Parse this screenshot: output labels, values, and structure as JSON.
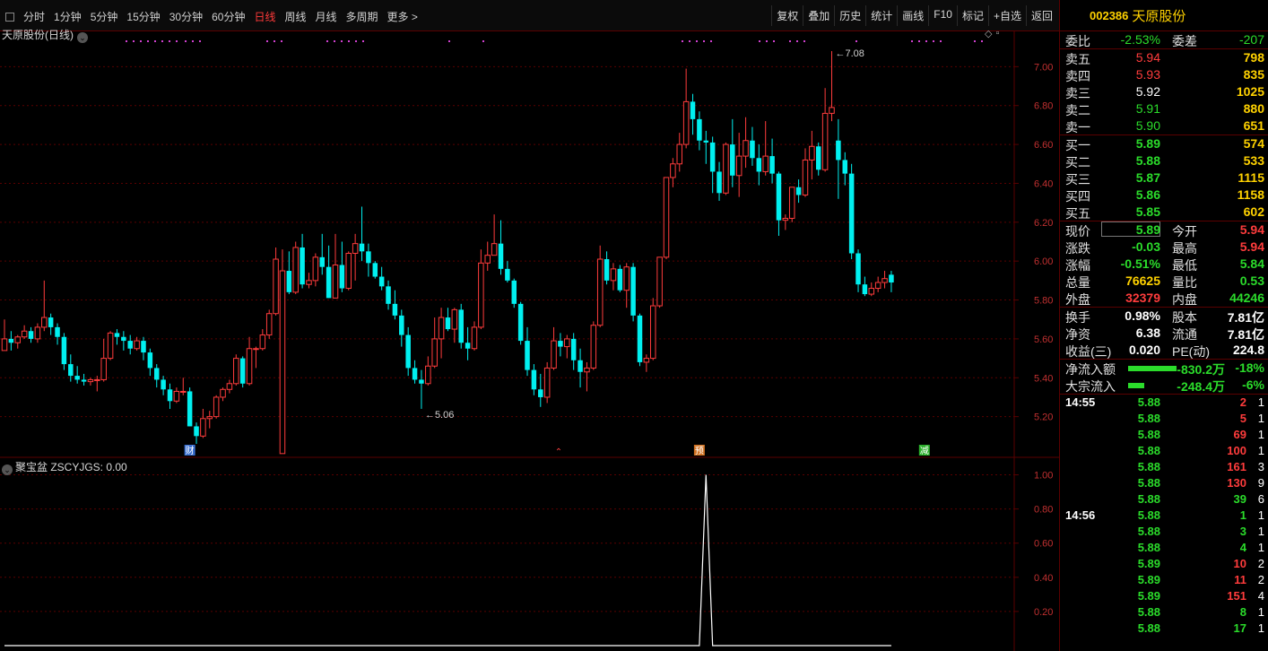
{
  "toolbar": {
    "periods": [
      "分时",
      "1分钟",
      "5分钟",
      "15分钟",
      "30分钟",
      "60分钟",
      "日线",
      "周线",
      "月线",
      "多周期",
      "更多 >"
    ],
    "active_period": "日线",
    "actions": [
      "复权",
      "叠加",
      "历史",
      "统计",
      "画线",
      "F10",
      "标记",
      "+自选",
      "返回"
    ]
  },
  "chart_title": "天原股份(日线)",
  "indicator_title": "聚宝盆  ZSCYJGS: 0.00",
  "colors": {
    "up": "#ff3c3c",
    "down": "#00f0f0",
    "grid": "#5a0000",
    "axis_text": "#c03030"
  },
  "chart_data": [
    {
      "type": "candlestick",
      "ylim": [
        5.0,
        7.14
      ],
      "yticks": [
        "7.00",
        "6.80",
        "6.60",
        "6.40",
        "6.20",
        "6.00",
        "5.80",
        "5.60",
        "5.40",
        "5.20"
      ],
      "annotations": {
        "high_label": "7.08",
        "low_label": "5.06"
      },
      "event_markers": [
        "财",
        "预",
        "减"
      ],
      "candles": [
        [
          5.54,
          5.7,
          5.57,
          5.6
        ],
        [
          5.6,
          5.64,
          5.54,
          5.58
        ],
        [
          5.58,
          5.62,
          5.55,
          5.61
        ],
        [
          5.61,
          5.67,
          5.6,
          5.64
        ],
        [
          5.64,
          5.66,
          5.58,
          5.6
        ],
        [
          5.6,
          5.68,
          5.58,
          5.66
        ],
        [
          5.66,
          5.9,
          5.64,
          5.71
        ],
        [
          5.71,
          5.73,
          5.62,
          5.66
        ],
        [
          5.66,
          5.68,
          5.57,
          5.61
        ],
        [
          5.61,
          5.63,
          5.44,
          5.47
        ],
        [
          5.47,
          5.52,
          5.38,
          5.41
        ],
        [
          5.41,
          5.46,
          5.37,
          5.39
        ],
        [
          5.39,
          5.42,
          5.36,
          5.38
        ],
        [
          5.38,
          5.4,
          5.36,
          5.39
        ],
        [
          5.39,
          5.41,
          5.33,
          5.39
        ],
        [
          5.39,
          5.6,
          5.38,
          5.5
        ],
        [
          5.5,
          5.64,
          5.49,
          5.63
        ],
        [
          5.63,
          5.65,
          5.57,
          5.61
        ],
        [
          5.61,
          5.64,
          5.54,
          5.59
        ],
        [
          5.59,
          5.62,
          5.52,
          5.55
        ],
        [
          5.55,
          5.61,
          5.54,
          5.59
        ],
        [
          5.59,
          5.61,
          5.49,
          5.53
        ],
        [
          5.53,
          5.55,
          5.41,
          5.45
        ],
        [
          5.45,
          5.47,
          5.35,
          5.39
        ],
        [
          5.39,
          5.41,
          5.31,
          5.34
        ],
        [
          5.34,
          5.37,
          5.24,
          5.28
        ],
        [
          5.28,
          5.35,
          5.27,
          5.33
        ],
        [
          5.33,
          5.4,
          5.31,
          5.33
        ],
        [
          5.33,
          5.35,
          5.17,
          5.15
        ],
        [
          5.15,
          5.17,
          5.06,
          5.1
        ],
        [
          5.1,
          5.24,
          5.09,
          5.19
        ],
        [
          5.19,
          5.23,
          5.14,
          5.2
        ],
        [
          5.2,
          5.31,
          5.19,
          5.3
        ],
        [
          5.3,
          5.35,
          5.28,
          5.34
        ],
        [
          5.34,
          5.39,
          5.32,
          5.37
        ],
        [
          5.37,
          5.52,
          5.36,
          5.5
        ],
        [
          5.5,
          5.51,
          5.35,
          5.37
        ],
        [
          5.37,
          5.61,
          5.36,
          5.55
        ],
        [
          5.55,
          5.56,
          5.45,
          5.55
        ],
        [
          5.55,
          5.65,
          5.54,
          5.62
        ],
        [
          5.62,
          5.75,
          5.6,
          5.73
        ],
        [
          5.73,
          6.07,
          5.72,
          6.01
        ],
        [
          5.01,
          6.06,
          5.88,
          5.95
        ],
        [
          5.95,
          6.05,
          5.83,
          5.84
        ],
        [
          5.84,
          6.1,
          5.83,
          6.07
        ],
        [
          6.07,
          6.14,
          5.86,
          5.88
        ],
        [
          5.88,
          5.94,
          5.86,
          5.9
        ],
        [
          5.9,
          6.04,
          5.87,
          6.02
        ],
        [
          6.02,
          6.14,
          5.93,
          5.97
        ],
        [
          5.97,
          6.08,
          5.81,
          5.81
        ],
        [
          5.81,
          6.14,
          5.81,
          5.98
        ],
        [
          5.98,
          6.1,
          5.84,
          5.86
        ],
        [
          5.86,
          6.05,
          5.85,
          6.04
        ],
        [
          6.04,
          6.14,
          5.9,
          6.09
        ],
        [
          6.09,
          6.28,
          6.0,
          6.05
        ],
        [
          6.05,
          6.09,
          5.92,
          5.99
        ],
        [
          5.99,
          6.0,
          5.91,
          5.92
        ],
        [
          5.92,
          5.97,
          5.85,
          5.87
        ],
        [
          5.87,
          5.9,
          5.75,
          5.78
        ],
        [
          5.78,
          5.85,
          5.7,
          5.72
        ],
        [
          5.72,
          5.75,
          5.56,
          5.62
        ],
        [
          5.62,
          5.66,
          5.41,
          5.45
        ],
        [
          5.45,
          5.49,
          5.37,
          5.39
        ],
        [
          5.39,
          5.44,
          5.24,
          5.37
        ],
        [
          5.37,
          5.51,
          5.36,
          5.46
        ],
        [
          5.46,
          5.71,
          5.45,
          5.6
        ],
        [
          5.6,
          5.76,
          5.5,
          5.71
        ],
        [
          5.71,
          5.76,
          5.64,
          5.65
        ],
        [
          5.65,
          5.76,
          5.58,
          5.75
        ],
        [
          5.75,
          5.78,
          5.55,
          5.58
        ],
        [
          5.58,
          5.66,
          5.49,
          5.55
        ],
        [
          5.55,
          5.69,
          5.54,
          5.66
        ],
        [
          5.66,
          6.06,
          5.65,
          5.99
        ],
        [
          5.99,
          6.1,
          5.95,
          6.03
        ],
        [
          6.03,
          6.24,
          6.03,
          6.09
        ],
        [
          6.09,
          6.21,
          5.93,
          5.96
        ],
        [
          5.96,
          6.0,
          5.89,
          5.9
        ],
        [
          5.9,
          5.91,
          5.76,
          5.78
        ],
        [
          5.78,
          5.79,
          5.57,
          5.59
        ],
        [
          5.59,
          5.66,
          5.41,
          5.44
        ],
        [
          5.44,
          5.47,
          5.31,
          5.34
        ],
        [
          5.34,
          5.42,
          5.25,
          5.3
        ],
        [
          5.3,
          5.48,
          5.27,
          5.45
        ],
        [
          5.45,
          5.66,
          5.44,
          5.59
        ],
        [
          5.59,
          5.63,
          5.51,
          5.56
        ],
        [
          5.56,
          5.62,
          5.5,
          5.6
        ],
        [
          5.6,
          5.63,
          5.44,
          5.49
        ],
        [
          5.49,
          5.55,
          5.35,
          5.43
        ],
        [
          5.43,
          5.48,
          5.33,
          5.45
        ],
        [
          5.45,
          5.69,
          5.44,
          5.67
        ],
        [
          5.67,
          6.08,
          5.66,
          6.01
        ],
        [
          6.01,
          6.05,
          5.88,
          5.9
        ],
        [
          5.9,
          5.99,
          5.85,
          5.96
        ],
        [
          5.96,
          5.98,
          5.84,
          5.85
        ],
        [
          5.85,
          5.99,
          5.76,
          5.97
        ],
        [
          5.97,
          5.99,
          5.69,
          5.72
        ],
        [
          5.72,
          5.73,
          5.46,
          5.48
        ],
        [
          5.48,
          5.52,
          5.43,
          5.5
        ],
        [
          5.5,
          5.81,
          5.49,
          5.77
        ],
        [
          5.77,
          6.0,
          5.76,
          6.02
        ],
        [
          6.02,
          6.4,
          6.01,
          6.43
        ],
        [
          6.43,
          6.53,
          6.38,
          6.5
        ],
        [
          6.5,
          6.66,
          6.46,
          6.6
        ],
        [
          6.6,
          6.99,
          6.58,
          6.82
        ],
        [
          6.82,
          6.86,
          6.65,
          6.73
        ],
        [
          6.73,
          6.77,
          6.57,
          6.62
        ],
        [
          6.62,
          6.67,
          6.5,
          6.61
        ],
        [
          6.61,
          6.64,
          6.35,
          6.46
        ],
        [
          6.46,
          6.51,
          6.31,
          6.35
        ],
        [
          6.35,
          6.61,
          6.34,
          6.6
        ],
        [
          6.6,
          6.73,
          6.38,
          6.44
        ],
        [
          6.44,
          6.66,
          6.33,
          6.54
        ],
        [
          6.54,
          6.74,
          6.48,
          6.62
        ],
        [
          6.62,
          6.69,
          6.49,
          6.53
        ],
        [
          6.53,
          6.6,
          6.39,
          6.46
        ],
        [
          6.46,
          6.72,
          6.44,
          6.54
        ],
        [
          6.54,
          6.63,
          6.4,
          6.45
        ],
        [
          6.45,
          6.46,
          6.13,
          6.21
        ],
        [
          6.21,
          6.24,
          6.16,
          6.22
        ],
        [
          6.22,
          6.38,
          6.2,
          6.38
        ],
        [
          6.38,
          6.42,
          6.3,
          6.34
        ],
        [
          6.34,
          6.58,
          6.33,
          6.52
        ],
        [
          6.52,
          6.67,
          6.42,
          6.59
        ],
        [
          6.59,
          6.61,
          6.44,
          6.47
        ],
        [
          6.47,
          6.89,
          6.46,
          6.76
        ],
        [
          6.76,
          7.08,
          6.72,
          6.79
        ],
        [
          6.79,
          6.73,
          6.32,
          6.52
        ],
        [
          6.52,
          6.56,
          6.39,
          6.45
        ],
        [
          6.45,
          6.5,
          6.01,
          6.04
        ],
        [
          6.04,
          6.06,
          5.84,
          5.88
        ],
        [
          5.88,
          5.92,
          5.82,
          5.83
        ],
        [
          5.83,
          5.89,
          5.82,
          5.86
        ],
        [
          5.86,
          5.92,
          5.84,
          5.89
        ],
        [
          5.89,
          5.95,
          5.86,
          5.91
        ],
        [
          5.93,
          5.95,
          5.84,
          5.89
        ]
      ]
    },
    {
      "type": "line",
      "name": "ZSCYJGS",
      "ylim": [
        0,
        1.05
      ],
      "yticks": [
        "1.00",
        "0.80",
        "0.60",
        "0.40",
        "0.20"
      ],
      "spike_index": 106,
      "spike_value": 1.0
    }
  ],
  "quote": {
    "code": "002386",
    "name": "天原股份",
    "weibi_label": "委比",
    "weibi": "-2.53%",
    "weicha_label": "委差",
    "weicha": "-207",
    "asks": [
      {
        "label": "卖五",
        "price": "5.94",
        "vol": "798"
      },
      {
        "label": "卖四",
        "price": "5.93",
        "vol": "835"
      },
      {
        "label": "卖三",
        "price": "5.92",
        "vol": "1025"
      },
      {
        "label": "卖二",
        "price": "5.91",
        "vol": "880"
      },
      {
        "label": "卖一",
        "price": "5.90",
        "vol": "651"
      }
    ],
    "bids": [
      {
        "label": "买一",
        "price": "5.89",
        "vol": "574"
      },
      {
        "label": "买二",
        "price": "5.88",
        "vol": "533"
      },
      {
        "label": "买三",
        "price": "5.87",
        "vol": "1115"
      },
      {
        "label": "买四",
        "price": "5.86",
        "vol": "1158"
      },
      {
        "label": "买五",
        "price": "5.85",
        "vol": "602"
      }
    ],
    "stats": [
      {
        "l1": "现价",
        "v1": "5.89",
        "l2": "今开",
        "v2": "5.94"
      },
      {
        "l1": "涨跌",
        "v1": "-0.03",
        "l2": "最高",
        "v2": "5.94"
      },
      {
        "l1": "涨幅",
        "v1": "-0.51%",
        "l2": "最低",
        "v2": "5.84"
      },
      {
        "l1": "总量",
        "v1": "76625",
        "l2": "量比",
        "v2": "0.53"
      },
      {
        "l1": "外盘",
        "v1": "32379",
        "l2": "内盘",
        "v2": "44246"
      }
    ],
    "fund": [
      {
        "l1": "换手",
        "v1": "0.98%",
        "l2": "股本",
        "v2": "7.81亿"
      },
      {
        "l1": "净资",
        "v1": "6.38",
        "l2": "流通",
        "v2": "7.81亿"
      },
      {
        "l1": "收益(三)",
        "v1": "0.020",
        "l2": "PE(动)",
        "v2": "224.8"
      }
    ],
    "flow": [
      {
        "label": "净流入额",
        "value": "-830.2万",
        "pct": "-18%",
        "bar": 0.18
      },
      {
        "label": "大宗流入",
        "value": "-248.4万",
        "pct": "-6%",
        "bar": 0.06
      }
    ]
  },
  "trades": [
    {
      "time": "14:55",
      "price": "5.88",
      "vol": "2",
      "n": "1",
      "dir": "up"
    },
    {
      "time": "",
      "price": "5.88",
      "vol": "5",
      "n": "1",
      "dir": "up"
    },
    {
      "time": "",
      "price": "5.88",
      "vol": "69",
      "n": "1",
      "dir": "up"
    },
    {
      "time": "",
      "price": "5.88",
      "vol": "100",
      "n": "1",
      "dir": "up"
    },
    {
      "time": "",
      "price": "5.88",
      "vol": "161",
      "n": "3",
      "dir": "up"
    },
    {
      "time": "",
      "price": "5.88",
      "vol": "130",
      "n": "9",
      "dir": "up"
    },
    {
      "time": "",
      "price": "5.88",
      "vol": "39",
      "n": "6",
      "dir": "down"
    },
    {
      "time": "14:56",
      "price": "5.88",
      "vol": "1",
      "n": "1",
      "dir": "down"
    },
    {
      "time": "",
      "price": "5.88",
      "vol": "3",
      "n": "1",
      "dir": "down"
    },
    {
      "time": "",
      "price": "5.88",
      "vol": "4",
      "n": "1",
      "dir": "down"
    },
    {
      "time": "",
      "price": "5.89",
      "vol": "10",
      "n": "2",
      "dir": "up"
    },
    {
      "time": "",
      "price": "5.89",
      "vol": "11",
      "n": "2",
      "dir": "up"
    },
    {
      "time": "",
      "price": "5.89",
      "vol": "151",
      "n": "4",
      "dir": "up"
    },
    {
      "time": "",
      "price": "5.88",
      "vol": "8",
      "n": "1",
      "dir": "down"
    },
    {
      "time": "",
      "price": "5.88",
      "vol": "17",
      "n": "1",
      "dir": "down"
    }
  ]
}
